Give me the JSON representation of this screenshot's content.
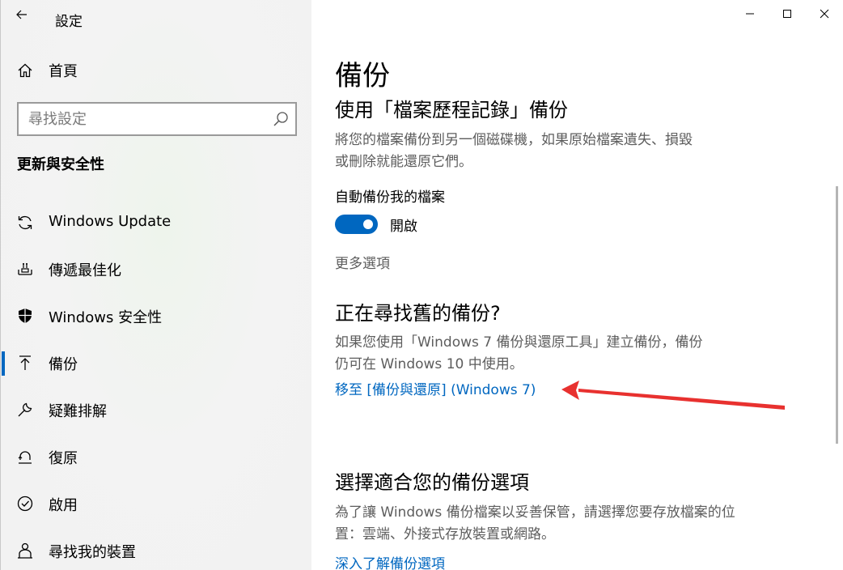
{
  "window": {
    "title": "設定"
  },
  "sidebar": {
    "home_label": "首頁",
    "search_placeholder": "尋找設定",
    "section_title": "更新與安全性",
    "items": [
      {
        "label": "Windows Update",
        "icon": "refresh-icon"
      },
      {
        "label": "傳遞最佳化",
        "icon": "delivery-optimization-icon"
      },
      {
        "label": "Windows 安全性",
        "icon": "shield-icon"
      },
      {
        "label": "備份",
        "icon": "backup-arrow-up-icon",
        "active": true
      },
      {
        "label": "疑難排解",
        "icon": "wrench-icon"
      },
      {
        "label": "復原",
        "icon": "recovery-icon"
      },
      {
        "label": "啟用",
        "icon": "check-circle-icon"
      },
      {
        "label": "尋找我的裝置",
        "icon": "person-location-icon"
      }
    ]
  },
  "main": {
    "page_title": "備份",
    "file_history": {
      "heading": "使用「檔案歷程記錄」備份",
      "description_line1": "將您的檔案備份到另一個磁碟機，如果原始檔案遺失、損毀",
      "description_line2": "或刪除就能還原它們。",
      "auto_backup_label": "自動備份我的檔案",
      "toggle_state": "開啟",
      "more_options": "更多選項"
    },
    "old_backup": {
      "heading": "正在尋找舊的備份?",
      "description_line1": "如果您使用「Windows 7 備份與還原工具」建立備份，備份",
      "description_line2": "仍可在 Windows 10 中使用。",
      "link": "移至 [備份與還原] (Windows 7)"
    },
    "choose_options": {
      "heading": "選擇適合您的備份選項",
      "description_line1": "為了讓 Windows 備份檔案以妥善保管，請選擇您要存放檔案的位",
      "description_line2": "置：雲端、外接式存放裝置或網路。",
      "link": "深入了解備份選項"
    }
  },
  "colors": {
    "accent": "#0067c0",
    "annotation_arrow": "#e8312f"
  }
}
